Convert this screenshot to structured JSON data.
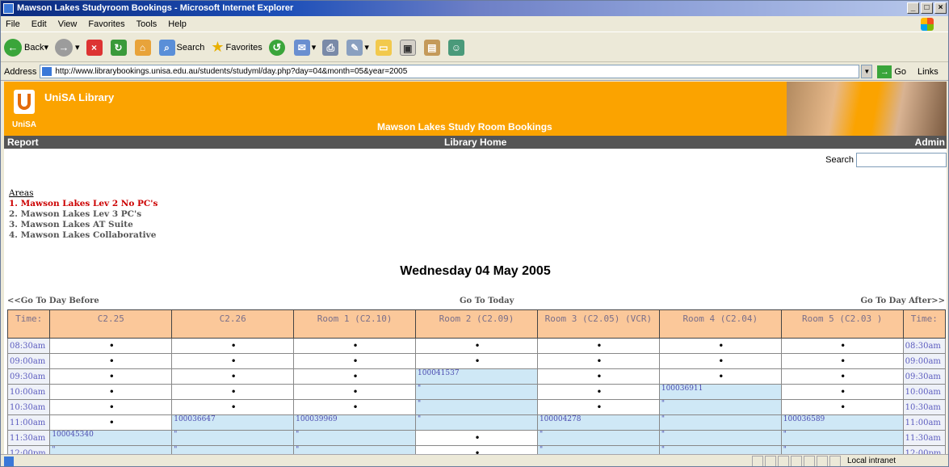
{
  "window": {
    "title": "Mawson Lakes Studyroom Bookings - Microsoft Internet Explorer",
    "buttons": [
      "_",
      "□",
      "×"
    ]
  },
  "menu": [
    "File",
    "Edit",
    "View",
    "Favorites",
    "Tools",
    "Help"
  ],
  "toolbar": {
    "back": "Back",
    "search": "Search",
    "favorites": "Favorites"
  },
  "address": {
    "label": "Address",
    "url": "http://www.librarybookings.unisa.edu.au/students/studyml/day.php?day=04&month=05&year=2005",
    "go": "Go",
    "links": "Links"
  },
  "banner": {
    "logo_text": "UniSA",
    "library": "UniSA Library",
    "title": "Mawson Lakes Study Room Bookings"
  },
  "nav": {
    "report": "Report",
    "home": "Library Home",
    "admin": "Admin"
  },
  "search": {
    "label": "Search"
  },
  "areas": {
    "heading": "Areas",
    "items": [
      "1. Mawson Lakes Lev 2 No PC's",
      "2. Mawson Lakes Lev 3 PC's",
      "3. Mawson Lakes AT Suite",
      "4. Mawson Lakes Collaborative"
    ]
  },
  "day_title": "Wednesday 04 May 2005",
  "day_nav": {
    "before": "<<Go To Day Before",
    "today": "Go To Today",
    "after": "Go To Day After>>"
  },
  "grid": {
    "headers": [
      "Time:",
      "C2.25",
      "C2.26",
      "Room 1 (C2.10)",
      "Room 2 (C2.09)",
      "Room 3 (C2.05) (VCR)",
      "Room 4 (C2.04)",
      "Room 5 (C2.03 )",
      "Time:"
    ],
    "rows": [
      {
        "time": "08:30am",
        "cells": [
          "•",
          "•",
          "•",
          "•",
          "•",
          "•",
          "•"
        ]
      },
      {
        "time": "09:00am",
        "cells": [
          "•",
          "•",
          "•",
          "•",
          "•",
          "•",
          "•"
        ]
      },
      {
        "time": "09:30am",
        "cells": [
          "•",
          "•",
          "•",
          "100041537",
          "•",
          "•",
          "•"
        ]
      },
      {
        "time": "10:00am",
        "cells": [
          "•",
          "•",
          "•",
          "\"",
          "•",
          "100036911",
          "•"
        ]
      },
      {
        "time": "10:30am",
        "cells": [
          "•",
          "•",
          "•",
          "\"",
          "•",
          "\"",
          "•"
        ]
      },
      {
        "time": "11:00am",
        "cells": [
          "•",
          "100036647",
          "100039969",
          "\"",
          "100004278",
          "\"",
          "100036589"
        ]
      },
      {
        "time": "11:30am",
        "cells": [
          "100045340",
          "\"",
          "\"",
          "•",
          "\"",
          "\"",
          "\""
        ]
      },
      {
        "time": "12:00pm",
        "cells": [
          "\"",
          "\"",
          "\"",
          "•",
          "\"",
          "\"",
          "\""
        ]
      }
    ]
  },
  "status": {
    "zone": "Local intranet"
  }
}
